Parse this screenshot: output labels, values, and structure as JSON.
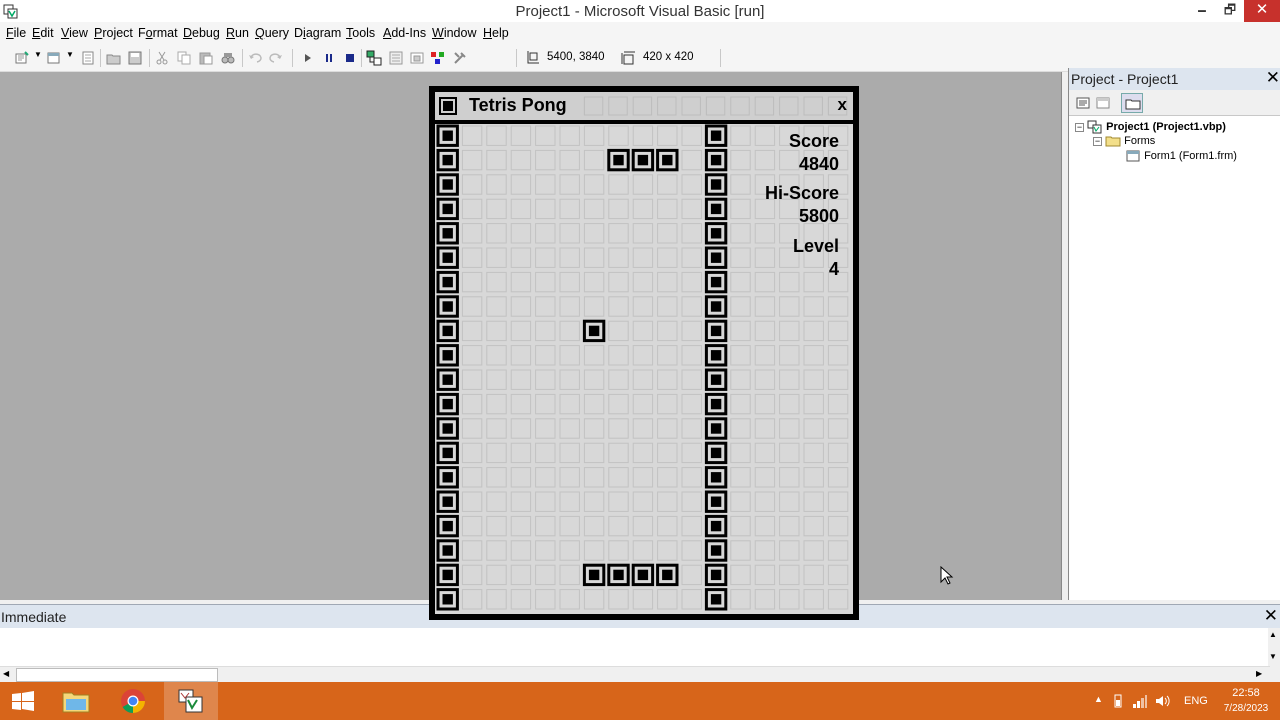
{
  "window": {
    "title": "Project1 - Microsoft Visual Basic [run]",
    "min_label": "🗕",
    "max_label": "🗗",
    "close_label": "✕"
  },
  "menu": [
    {
      "label": "File",
      "accel": "F",
      "rest": "ile"
    },
    {
      "label": "Edit",
      "accel": "E",
      "rest": "dit"
    },
    {
      "label": "View",
      "accel": "V",
      "rest": "iew"
    },
    {
      "label": "Project",
      "accel": "P",
      "rest": "roject"
    },
    {
      "label": "Format",
      "accel": "o",
      "pre": "F",
      "rest": "rmat"
    },
    {
      "label": "Debug",
      "accel": "D",
      "rest": "ebug"
    },
    {
      "label": "Run",
      "accel": "R",
      "rest": "un"
    },
    {
      "label": "Query",
      "accel": "Q",
      "rest": "uery"
    },
    {
      "label": "Diagram",
      "accel": "i",
      "pre": "D",
      "rest": "agram"
    },
    {
      "label": "Tools",
      "accel": "T",
      "rest": "ools"
    },
    {
      "label": "Add-Ins",
      "accel": "A",
      "rest": "dd-Ins"
    },
    {
      "label": "Window",
      "accel": "W",
      "rest": "indow"
    },
    {
      "label": "Help",
      "accel": "H",
      "rest": "elp"
    }
  ],
  "toolbar": {
    "position_readout": "5400, 3840",
    "size_readout": "420 x 420"
  },
  "project_panel": {
    "title": "Project - Project1",
    "close_label": "✕",
    "tree": {
      "project": "Project1 (Project1.vbp)",
      "folder": "Forms",
      "form": "Form1 (Form1.frm)"
    }
  },
  "immediate": {
    "title": "Immediate",
    "close_label": "✕"
  },
  "game": {
    "title": "Tetris Pong",
    "close_label": "x",
    "score_label": "Score",
    "score_value": "4840",
    "hiscore_label": "Hi-Score",
    "hiscore_value": "5800",
    "level_label": "Level",
    "level_value": "4",
    "rows": 20,
    "play_cols": 11,
    "walls": {
      "left_col": 0,
      "right_col": 11
    },
    "paddle_top": {
      "row": 1,
      "cols": [
        7,
        8,
        9
      ]
    },
    "ball": {
      "row": 8,
      "col": 6
    },
    "paddle_bottom": {
      "row": 18,
      "cols": [
        6,
        7,
        8,
        9
      ]
    }
  },
  "taskbar": {
    "language": "ENG",
    "time": "22:58",
    "date": "7/28/2023",
    "apps": [
      "start-icon",
      "file-explorer-icon",
      "chrome-icon",
      "visual-basic-icon"
    ]
  }
}
